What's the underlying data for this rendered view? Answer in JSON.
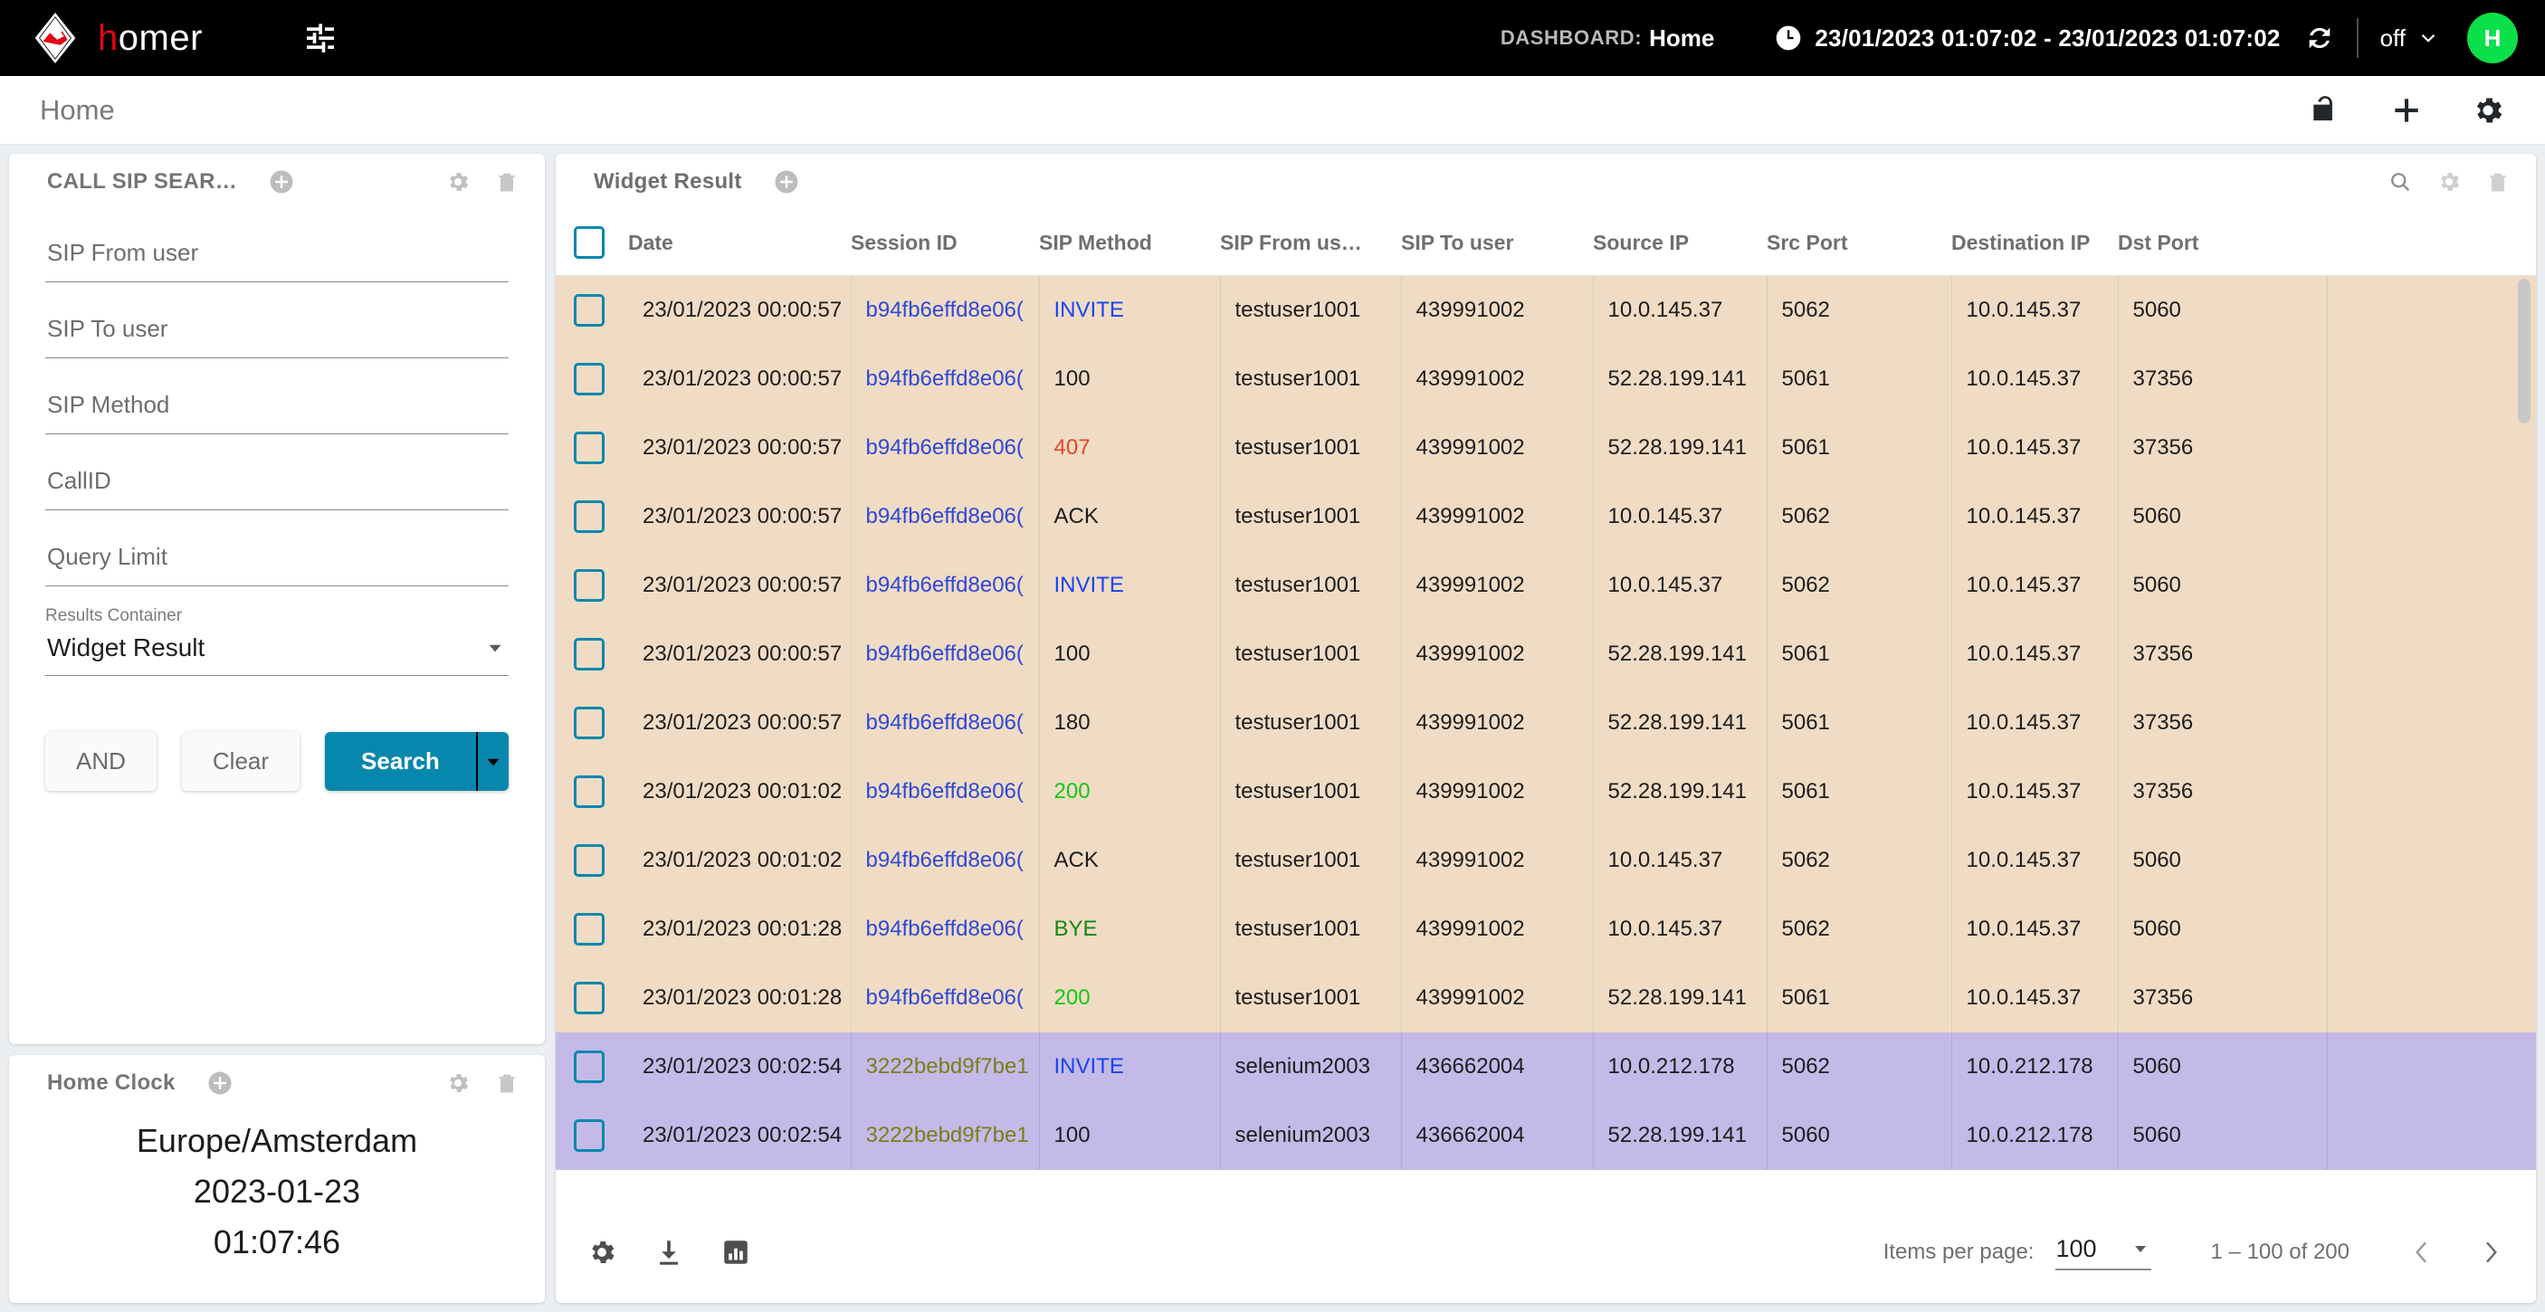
{
  "topbar": {
    "brand_h": "h",
    "brand_rest": "omer",
    "tune_icon": "tune-icon",
    "dashboard_label": "DASHBOARD:",
    "dashboard_value": "Home",
    "clock_icon": "clock-icon",
    "time_range": "23/01/2023 01:07:02 - 23/01/2023 01:07:02",
    "refresh_icon": "refresh-icon",
    "refresh_interval": "off",
    "avatar_initial": "H",
    "accent_green": "#0ae04a",
    "brand_red": "#e30613"
  },
  "subheader": {
    "title": "Home",
    "icons": [
      "unlock-icon",
      "plus-icon",
      "gear-icon"
    ]
  },
  "search_widget": {
    "title": "CALL SIP SEAR…",
    "add_icon": "add-circle-icon",
    "gear_icon": "gear-icon",
    "delete_icon": "trash-icon",
    "fields": [
      {
        "name": "sip-from-user",
        "placeholder": "SIP From user",
        "value": ""
      },
      {
        "name": "sip-to-user",
        "placeholder": "SIP To user",
        "value": ""
      },
      {
        "name": "sip-method",
        "placeholder": "SIP Method",
        "value": ""
      },
      {
        "name": "callid",
        "placeholder": "CallID",
        "value": ""
      },
      {
        "name": "query-limit",
        "placeholder": "Query Limit",
        "value": ""
      }
    ],
    "results_container_label": "Results Container",
    "results_container_value": "Widget Result",
    "buttons": {
      "and": "AND",
      "clear": "Clear",
      "search": "Search",
      "search_accent": "#0787ad"
    }
  },
  "clock_widget": {
    "title": "Home Clock",
    "add_icon": "add-circle-icon",
    "gear_icon": "gear-icon",
    "delete_icon": "trash-icon",
    "timezone": "Europe/Amsterdam",
    "date": "2023-01-23",
    "time": "01:07:46"
  },
  "result_widget": {
    "title": "Widget Result",
    "add_icon": "add-circle-icon",
    "search_icon": "search-icon",
    "gear_icon": "gear-icon",
    "delete_icon": "trash-icon",
    "columns": [
      "Date",
      "Session ID",
      "SIP Method",
      "SIP From us…",
      "SIP To user",
      "Source IP",
      "Src Port",
      "Destination IP",
      "Dst Port"
    ],
    "rows": [
      {
        "group": "a",
        "date": "23/01/2023 00:00:57",
        "session": "b94fb6effd8e06(",
        "session_style": "sess",
        "method": "INVITE",
        "method_style": "m-invite",
        "from": "testuser1001",
        "to": "439991002",
        "src_ip": "10.0.145.37",
        "src_port": "5062",
        "dst_ip": "10.0.145.37",
        "dst_port": "5060"
      },
      {
        "group": "a",
        "date": "23/01/2023 00:00:57",
        "session": "b94fb6effd8e06(",
        "session_style": "sess",
        "method": "100",
        "method_style": "m-plain",
        "from": "testuser1001",
        "to": "439991002",
        "src_ip": "52.28.199.141",
        "src_port": "5061",
        "dst_ip": "10.0.145.37",
        "dst_port": "37356"
      },
      {
        "group": "a",
        "date": "23/01/2023 00:00:57",
        "session": "b94fb6effd8e06(",
        "session_style": "sess",
        "method": "407",
        "method_style": "m-red",
        "from": "testuser1001",
        "to": "439991002",
        "src_ip": "52.28.199.141",
        "src_port": "5061",
        "dst_ip": "10.0.145.37",
        "dst_port": "37356"
      },
      {
        "group": "a",
        "date": "23/01/2023 00:00:57",
        "session": "b94fb6effd8e06(",
        "session_style": "sess",
        "method": "ACK",
        "method_style": "m-plain",
        "from": "testuser1001",
        "to": "439991002",
        "src_ip": "10.0.145.37",
        "src_port": "5062",
        "dst_ip": "10.0.145.37",
        "dst_port": "5060"
      },
      {
        "group": "a",
        "date": "23/01/2023 00:00:57",
        "session": "b94fb6effd8e06(",
        "session_style": "sess",
        "method": "INVITE",
        "method_style": "m-invite",
        "from": "testuser1001",
        "to": "439991002",
        "src_ip": "10.0.145.37",
        "src_port": "5062",
        "dst_ip": "10.0.145.37",
        "dst_port": "5060"
      },
      {
        "group": "a",
        "date": "23/01/2023 00:00:57",
        "session": "b94fb6effd8e06(",
        "session_style": "sess",
        "method": "100",
        "method_style": "m-plain",
        "from": "testuser1001",
        "to": "439991002",
        "src_ip": "52.28.199.141",
        "src_port": "5061",
        "dst_ip": "10.0.145.37",
        "dst_port": "37356"
      },
      {
        "group": "a",
        "date": "23/01/2023 00:00:57",
        "session": "b94fb6effd8e06(",
        "session_style": "sess",
        "method": "180",
        "method_style": "m-plain",
        "from": "testuser1001",
        "to": "439991002",
        "src_ip": "52.28.199.141",
        "src_port": "5061",
        "dst_ip": "10.0.145.37",
        "dst_port": "37356"
      },
      {
        "group": "a",
        "date": "23/01/2023 00:01:02",
        "session": "b94fb6effd8e06(",
        "session_style": "sess",
        "method": "200",
        "method_style": "m-green",
        "from": "testuser1001",
        "to": "439991002",
        "src_ip": "52.28.199.141",
        "src_port": "5061",
        "dst_ip": "10.0.145.37",
        "dst_port": "37356"
      },
      {
        "group": "a",
        "date": "23/01/2023 00:01:02",
        "session": "b94fb6effd8e06(",
        "session_style": "sess",
        "method": "ACK",
        "method_style": "m-plain",
        "from": "testuser1001",
        "to": "439991002",
        "src_ip": "10.0.145.37",
        "src_port": "5062",
        "dst_ip": "10.0.145.37",
        "dst_port": "5060"
      },
      {
        "group": "a",
        "date": "23/01/2023 00:01:28",
        "session": "b94fb6effd8e06(",
        "session_style": "sess",
        "method": "BYE",
        "method_style": "m-darkgreen",
        "from": "testuser1001",
        "to": "439991002",
        "src_ip": "10.0.145.37",
        "src_port": "5062",
        "dst_ip": "10.0.145.37",
        "dst_port": "5060"
      },
      {
        "group": "a",
        "date": "23/01/2023 00:01:28",
        "session": "b94fb6effd8e06(",
        "session_style": "sess",
        "method": "200",
        "method_style": "m-green",
        "from": "testuser1001",
        "to": "439991002",
        "src_ip": "52.28.199.141",
        "src_port": "5061",
        "dst_ip": "10.0.145.37",
        "dst_port": "37356"
      },
      {
        "group": "b",
        "date": "23/01/2023 00:02:54",
        "session": "3222bebd9f7be1",
        "session_style": "sess-olive",
        "method": "INVITE",
        "method_style": "m-invite",
        "from": "selenium2003",
        "to": "436662004",
        "src_ip": "10.0.212.178",
        "src_port": "5062",
        "dst_ip": "10.0.212.178",
        "dst_port": "5060"
      },
      {
        "group": "b",
        "date": "23/01/2023 00:02:54",
        "session": "3222bebd9f7be1",
        "session_style": "sess-olive",
        "method": "100",
        "method_style": "m-plain",
        "from": "selenium2003",
        "to": "436662004",
        "src_ip": "52.28.199.141",
        "src_port": "5060",
        "dst_ip": "10.0.212.178",
        "dst_port": "5060"
      }
    ],
    "footer": {
      "settings_icon": "gear-icon",
      "download_icon": "download-icon",
      "chart_icon": "bar-chart-icon",
      "items_per_page_label": "Items per page:",
      "items_per_page_value": "100",
      "range_label": "1 – 100 of 200",
      "prev_icon": "chevron-left-icon",
      "next_icon": "chevron-right-icon"
    }
  }
}
